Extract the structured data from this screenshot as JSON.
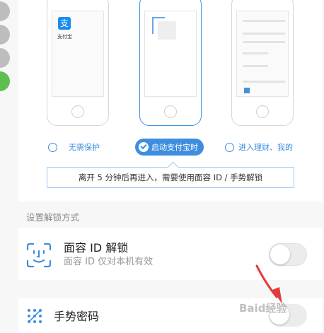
{
  "protection": {
    "options": [
      {
        "label": "无需保护",
        "checked": false
      },
      {
        "label": "启动支付宝时",
        "checked": true
      },
      {
        "label": "进入理财、我的",
        "checked": false
      }
    ],
    "app_name": "支付宝",
    "app_logo_glyph": "支",
    "tooltip": "离开 5 分钟后再进入，需要使用面容 ID / 手势解锁"
  },
  "unlock": {
    "section_header": "设置解锁方式",
    "face_id": {
      "title": "面容 ID 解锁",
      "subtitle": "面容 ID 仅对本机有效",
      "enabled": false
    },
    "gesture": {
      "title": "手势密码",
      "enabled": false
    }
  },
  "watermark": "Baid经验",
  "colors": {
    "accent": "#3e8ee0",
    "alipay_blue": "#1a8cf0",
    "arrow_red": "#e23b3b"
  },
  "icons": [
    "face-id-icon",
    "gesture-dots-icon",
    "check-icon",
    "alipay-logo-icon",
    "red-arrow-icon"
  ]
}
